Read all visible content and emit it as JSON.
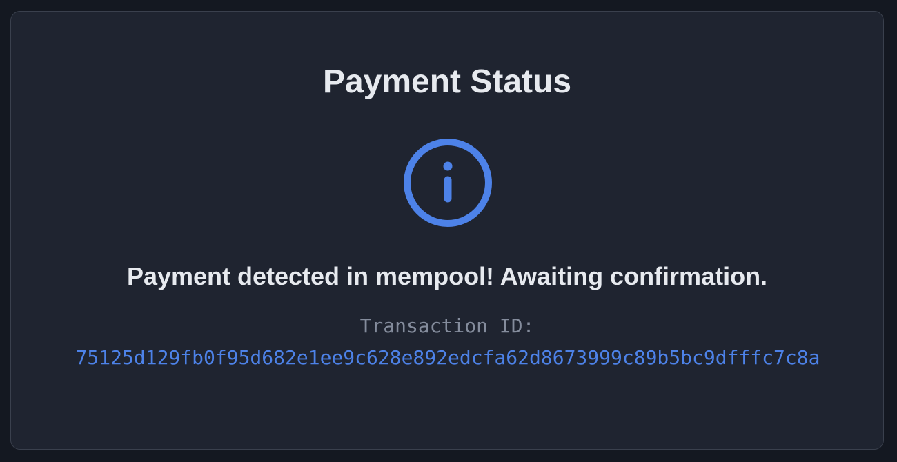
{
  "payment_status": {
    "title": "Payment Status",
    "status_icon": "info-icon",
    "accent_color": "#4d82e8",
    "message": "Payment detected in mempool! Awaiting confirmation.",
    "transaction_label": "Transaction ID:",
    "transaction_id": "75125d129fb0f95d682e1ee9c628e892edcfa62d8673999c89b5bc9dfffc7c8a"
  }
}
